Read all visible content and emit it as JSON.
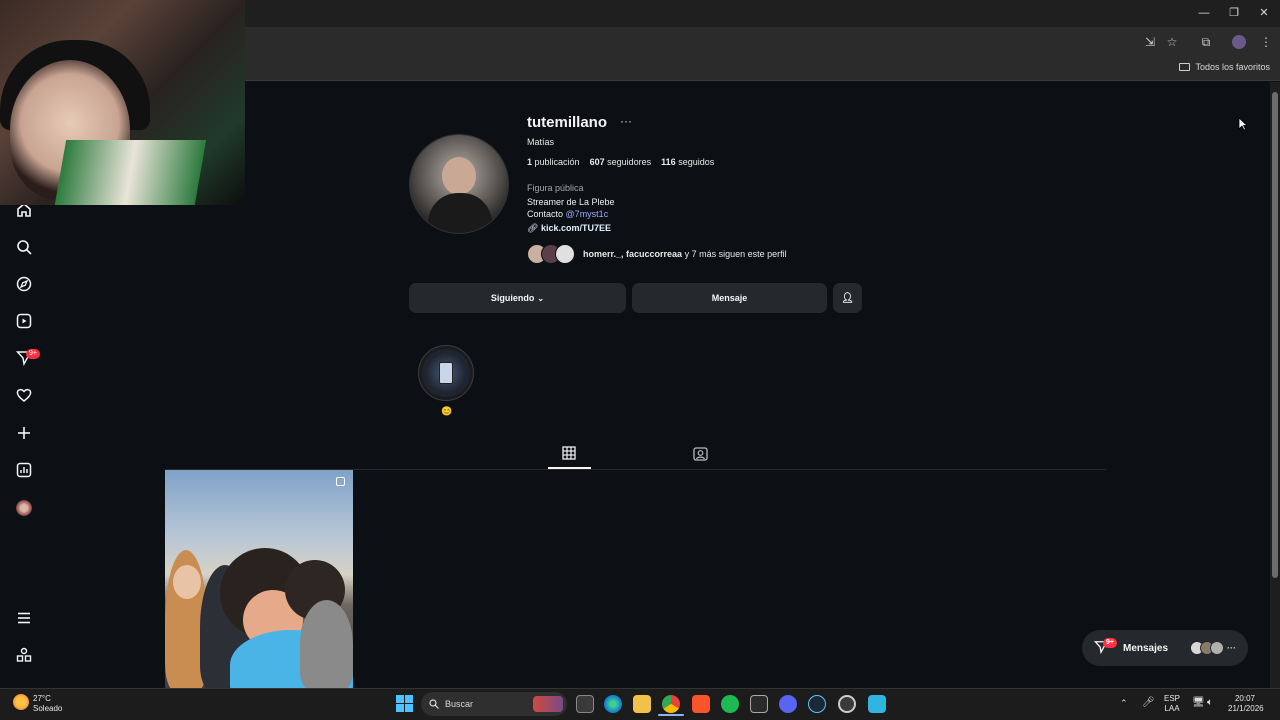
{
  "browser": {
    "bookmarks_folder": "Todos los favoritos",
    "window_controls": [
      "minimize",
      "maximize",
      "close"
    ]
  },
  "sidebar": {
    "items": [
      {
        "icon": "home-icon"
      },
      {
        "icon": "search-icon"
      },
      {
        "icon": "explore-icon"
      },
      {
        "icon": "reels-icon"
      },
      {
        "icon": "messages-icon",
        "badge": "9+"
      },
      {
        "icon": "heart-icon"
      },
      {
        "icon": "create-icon"
      },
      {
        "icon": "dashboard-icon"
      },
      {
        "icon": "profile-avatar"
      }
    ],
    "more_icon": "menu-icon",
    "meta_icon": "also-from-meta-icon"
  },
  "profile": {
    "username": "tutemillano",
    "more": "···",
    "full_name": "Matías",
    "stats": {
      "posts_count": "1",
      "posts_label": "publicación",
      "followers_count": "607",
      "followers_label": "seguidores",
      "following_count": "116",
      "following_label": "seguidos"
    },
    "category": "Figura pública",
    "bio_line": "Streamer de La Plebe",
    "contact_label": "Contacto",
    "contact_handle": "@7myst1c",
    "external_link": "kick.com/TU7EE",
    "followed_by_names": "homerr._, facuccorreaa",
    "followed_by_rest": " y 7 más siguen este perfil",
    "buttons": {
      "following": "Siguiendo",
      "message": "Mensaje"
    },
    "highlight_emoji": "😊"
  },
  "messages_bar": {
    "label": "Mensajes",
    "badge": "9+",
    "more": "···"
  },
  "taskbar": {
    "weather_temp": "27°C",
    "weather_desc": "Soleado",
    "search_placeholder": "Buscar",
    "lang_top": "ESP",
    "lang_bottom": "LAA",
    "time": "20:07",
    "date": "21/1/2026"
  }
}
